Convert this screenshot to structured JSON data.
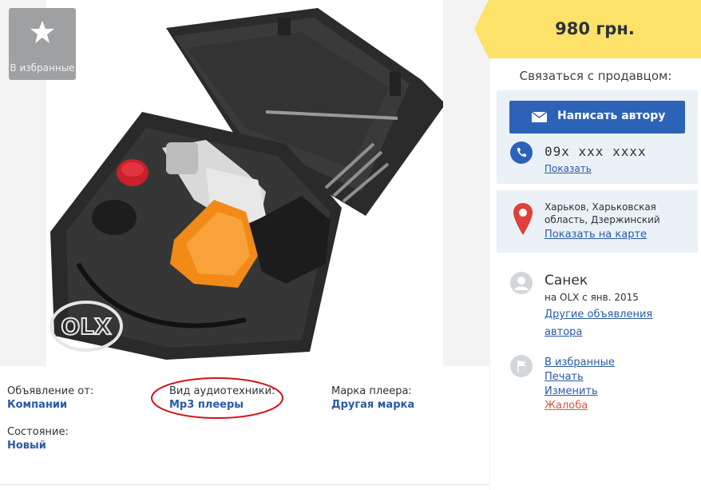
{
  "listing": {
    "favorite_label": "В избранные",
    "watermark": "OLX"
  },
  "params": [
    {
      "key": "Объявление от:",
      "value": "Компании"
    },
    {
      "key": "Вид аудиотехники:",
      "value": "Mp3 плееры"
    },
    {
      "key": "Марка плеера:",
      "value": "Другая марка"
    },
    {
      "key": "Состояние:",
      "value": "Новый"
    }
  ],
  "sidebar": {
    "price": "980 грн.",
    "contact_title": "Связаться с продавцом:",
    "write_button": "Написать автору",
    "phone": "09x xxx xxxx",
    "show_phone": "Показать",
    "address": "Харьков, Харьковская область, Дзержинский",
    "show_map": "Показать на карте",
    "user_name": "Санек",
    "since": "на OLX с янв. 2015",
    "other_ads": "Другие объявления автора",
    "actions": [
      "В избранные",
      "Печать",
      "Изменить",
      "Жалоба"
    ]
  },
  "colors": {
    "price_tag": "#fde26a",
    "button": "#2c63b8",
    "link": "#2a5aa3",
    "complaint": "#d35a48",
    "highlight_ellipse": "#d0131b"
  },
  "icons": [
    "star-icon",
    "envelope-icon",
    "phone-icon",
    "map-pin-icon",
    "user-avatar-icon",
    "flag-icon"
  ]
}
